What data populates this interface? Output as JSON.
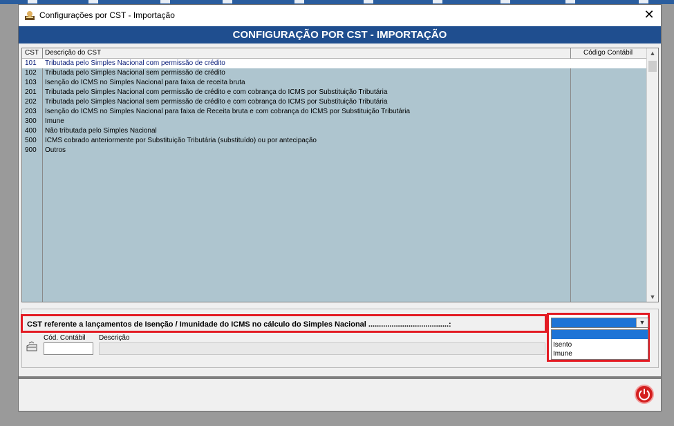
{
  "window": {
    "title": "Configurações por CST - Importação",
    "close_glyph": "✕",
    "title_icon": "config-person-icon"
  },
  "banner": {
    "text": "CONFIGURAÇÃO POR CST - IMPORTAÇÃO"
  },
  "grid": {
    "headers": {
      "cst": "CST",
      "descricao": "Descrição do CST",
      "codigo": "Código Contábil"
    },
    "rows": [
      {
        "cst": "101",
        "desc": "Tributada pelo Simples Nacional com permissão de crédito",
        "codigo": ""
      },
      {
        "cst": "102",
        "desc": "Tributada pelo Simples Nacional sem permissão de crédito",
        "codigo": ""
      },
      {
        "cst": "103",
        "desc": "Isenção do ICMS no Simples Nacional para faixa de receita bruta",
        "codigo": ""
      },
      {
        "cst": "201",
        "desc": "Tributada pelo Simples Nacional com permissão de crédito e com cobrança do ICMS por Substituição Tributária",
        "codigo": ""
      },
      {
        "cst": "202",
        "desc": "Tributada pelo Simples Nacional sem permissão de crédito e com cobrança do ICMS por Substituição Tributária",
        "codigo": ""
      },
      {
        "cst": "203",
        "desc": "Isenção do ICMS no Simples Nacional para faixa de Receita bruta e com cobrança do ICMS por Substituição Tributária",
        "codigo": ""
      },
      {
        "cst": "300",
        "desc": "Imune",
        "codigo": ""
      },
      {
        "cst": "400",
        "desc": "Não tributada pelo Simples Nacional",
        "codigo": ""
      },
      {
        "cst": "500",
        "desc": "ICMS cobrado anteriormente por Substituição Tributária (substituído) ou por antecipação",
        "codigo": ""
      },
      {
        "cst": "900",
        "desc": "Outros",
        "codigo": ""
      }
    ],
    "selected_row": 0
  },
  "isencao": {
    "label": "CST referente a lançamentos de Isenção / Imunidade do ICMS no cálculo do Simples Nacional ......................................:",
    "selected_value": "",
    "options": [
      "",
      "Isento",
      "Imune"
    ]
  },
  "fields": {
    "cod_contabil_label": "Cód. Contábil",
    "cod_contabil_value": "",
    "descricao_label": "Descrição",
    "descricao_value": ""
  },
  "colors": {
    "banner": "#1f4e8f",
    "grid_bg": "#aec5cf",
    "highlight": "#e31b23",
    "selection": "#1e74d6",
    "power": "#d41f1f"
  }
}
